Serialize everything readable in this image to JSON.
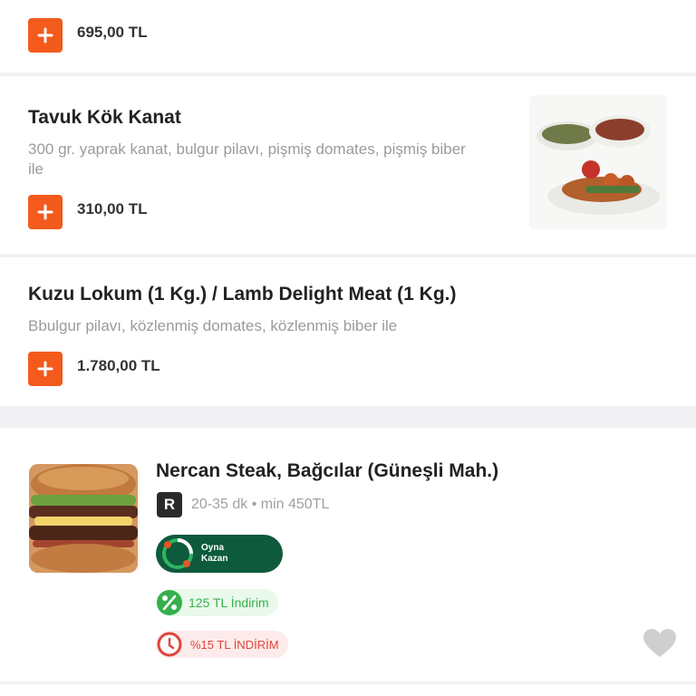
{
  "products": [
    {
      "name": "",
      "description": "",
      "price": "695,00 TL"
    },
    {
      "name": "Tavuk Kök Kanat",
      "description": "300 gr. yaprak kanat, bulgur pilavı, pişmiş domates, pişmiş biber ile",
      "price": "310,00 TL"
    },
    {
      "name": "Kuzu Lokum (1 Kg.) / Lamb Delight Meat (1 Kg.)",
      "description": "Bbulgur pilavı, közlenmiş domates, közlenmiş biber ile",
      "price": "1.780,00 TL"
    }
  ],
  "restaurant": {
    "name": "Nercan Steak, Bağcılar (Güneşli Mah.)",
    "badge": "R",
    "meta": "20-35 dk • min 450TL",
    "play_earn_line1": "Oyna",
    "play_earn_line2": "Kazan",
    "discount": "125 TL İndirim",
    "deal": "%15 TL İNDİRİM"
  },
  "colors": {
    "accent": "#f35a1c",
    "play_earn_bg": "#0e5a3c",
    "discount_green": "#36b04c",
    "deal_red": "#e0453a"
  },
  "icons": [
    "plus-icon",
    "restaurant-r-icon",
    "percent-icon",
    "clock-icon",
    "heart-icon"
  ]
}
